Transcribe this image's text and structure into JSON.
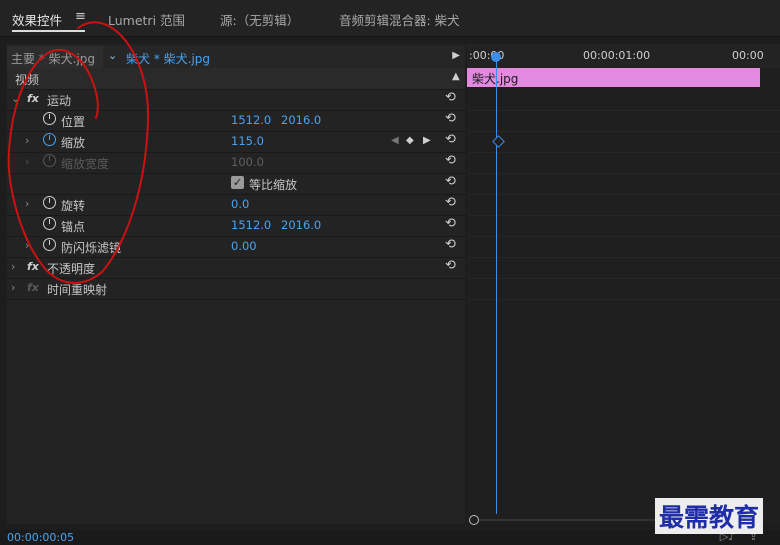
{
  "tabs": [
    {
      "label": "效果控件",
      "active": true
    },
    {
      "label": "Lumetri 范围",
      "active": false
    },
    {
      "label": "源:（无剪辑）",
      "active": false
    },
    {
      "label": "音频剪辑混合器: 柴犬",
      "active": false
    }
  ],
  "tab_menu_glyph": "≡",
  "clip_selector": {
    "master_label": "主要 * 柴犬.jpg",
    "sequence_label": "柴犬 * 柴犬.jpg"
  },
  "sections": {
    "video": "视频",
    "motion": "运动",
    "opacity": "不透明度",
    "time_remap": "时间重映射"
  },
  "fx_glyph": "fx",
  "properties": {
    "position": {
      "label": "位置",
      "x": "1512.0",
      "y": "2016.0"
    },
    "scale": {
      "label": "缩放",
      "value": "115.0"
    },
    "scale_width": {
      "label": "缩放宽度",
      "value": "100.0"
    },
    "uniform_scale": {
      "label": "等比缩放",
      "checked": true
    },
    "rotation": {
      "label": "旋转",
      "value": "0.0"
    },
    "anchor": {
      "label": "锚点",
      "x": "1512.0",
      "y": "2016.0"
    },
    "anti_flicker": {
      "label": "防闪烁滤镜",
      "value": "0.00"
    }
  },
  "timeline": {
    "tc_start": ":00:00",
    "tc_mid": "00:00:01:00",
    "tc_end": "00:00",
    "clip_label": "柴犬.jpg",
    "clip_color": "#e489e0"
  },
  "current_timecode": "00:00:00:05",
  "watermark": "最需教育",
  "colors": {
    "accent": "#4aa3f0",
    "annotation": "#cc1111"
  }
}
